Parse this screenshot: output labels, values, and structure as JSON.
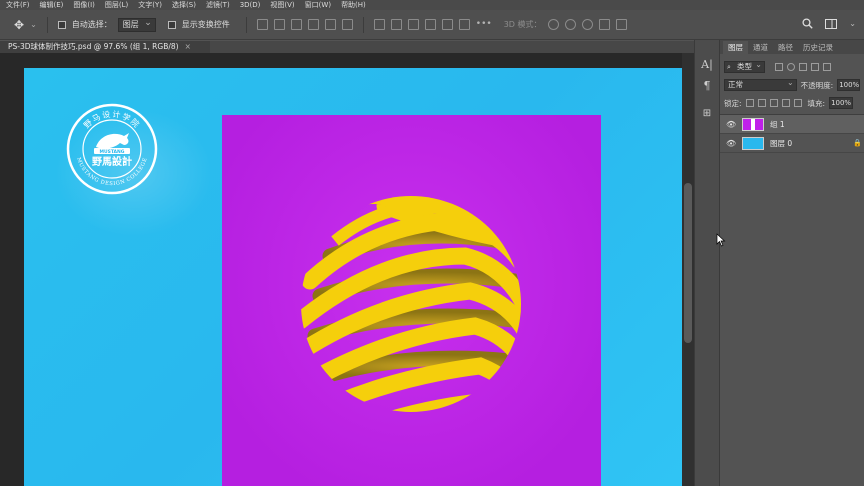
{
  "menu": [
    "文件(F)",
    "编辑(E)",
    "图像(I)",
    "图层(L)",
    "文字(Y)",
    "选择(S)",
    "滤镜(T)",
    "3D(D)",
    "视图(V)",
    "窗口(W)",
    "帮助(H)"
  ],
  "options": {
    "auto_select_label": "自动选择：",
    "auto_select_value": "图层",
    "show_transform_label": "显示变换控件",
    "mode_3d_label": "3D 模式："
  },
  "document": {
    "tab_title": "PS-3D球体制作技巧.psd @ 97.6% (组 1, RGB/8)",
    "close": "×"
  },
  "logo": {
    "top_text": "野马设计学院",
    "main_text": "野馬設計",
    "banner_text": "MUSTANG",
    "ring_text": "MUSTANG DESIGN COLLEGE"
  },
  "colors": {
    "canvas_bg": "#29b8ee",
    "magenta": "#c020ea",
    "ball": "#f5cf0c",
    "ball_inner": "#a88a18"
  },
  "panel": {
    "tabs": [
      "图层",
      "通道",
      "路径",
      "历史记录"
    ],
    "filter_label": "类型",
    "blend_mode": "正常",
    "opacity_label": "不透明度:",
    "opacity_value": "100%",
    "lock_label": "锁定:",
    "fill_label": "填充:",
    "fill_value": "100%",
    "layers": [
      {
        "name": "组 1",
        "selected": true
      },
      {
        "name": "图层 0",
        "selected": false
      }
    ]
  },
  "tools": {
    "text_icon": "A|",
    "paragraph_icon": "¶"
  }
}
